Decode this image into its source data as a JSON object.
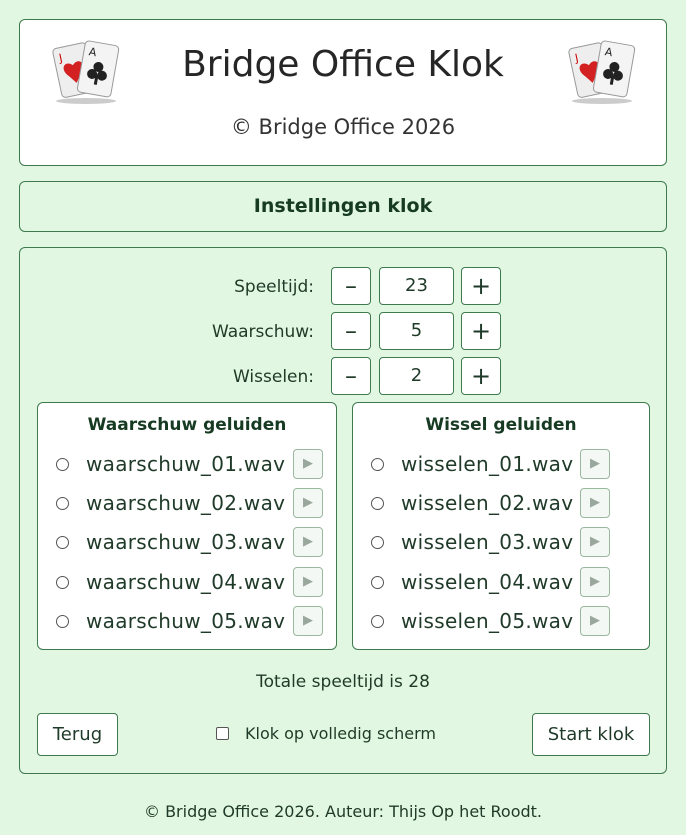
{
  "header": {
    "title": "Bridge Office Klok",
    "copyright": "© Bridge Office 2026"
  },
  "section_title": "Instellingen klok",
  "steppers": [
    {
      "label": "Speeltijd:",
      "value": "23",
      "minus": "–",
      "plus": "+"
    },
    {
      "label": "Waarschuw:",
      "value": "5",
      "minus": "–",
      "plus": "+"
    },
    {
      "label": "Wisselen:",
      "value": "2",
      "minus": "–",
      "plus": "+"
    }
  ],
  "warn_sounds": {
    "title": "Waarschuw geluiden",
    "files": [
      "waarschuw_01.wav",
      "waarschuw_02.wav",
      "waarschuw_03.wav",
      "waarschuw_04.wav",
      "waarschuw_05.wav"
    ]
  },
  "swap_sounds": {
    "title": "Wissel geluiden",
    "files": [
      "wisselen_01.wav",
      "wisselen_02.wav",
      "wisselen_03.wav",
      "wisselen_04.wav",
      "wisselen_05.wav"
    ]
  },
  "play_glyph": "▶",
  "total_text": "Totale speeltijd is 28",
  "buttons": {
    "back": "Terug",
    "start": "Start klok"
  },
  "fullscreen_label": "Klok op volledig scherm",
  "footer": "© Bridge Office 2026. Auteur: Thijs Op het Roodt.",
  "icons": {
    "card_left": "playing-cards-icon",
    "card_right": "playing-cards-icon"
  },
  "colors": {
    "background": "#e1f7e1",
    "border": "#3f7a4f",
    "heart": "#d32020"
  }
}
